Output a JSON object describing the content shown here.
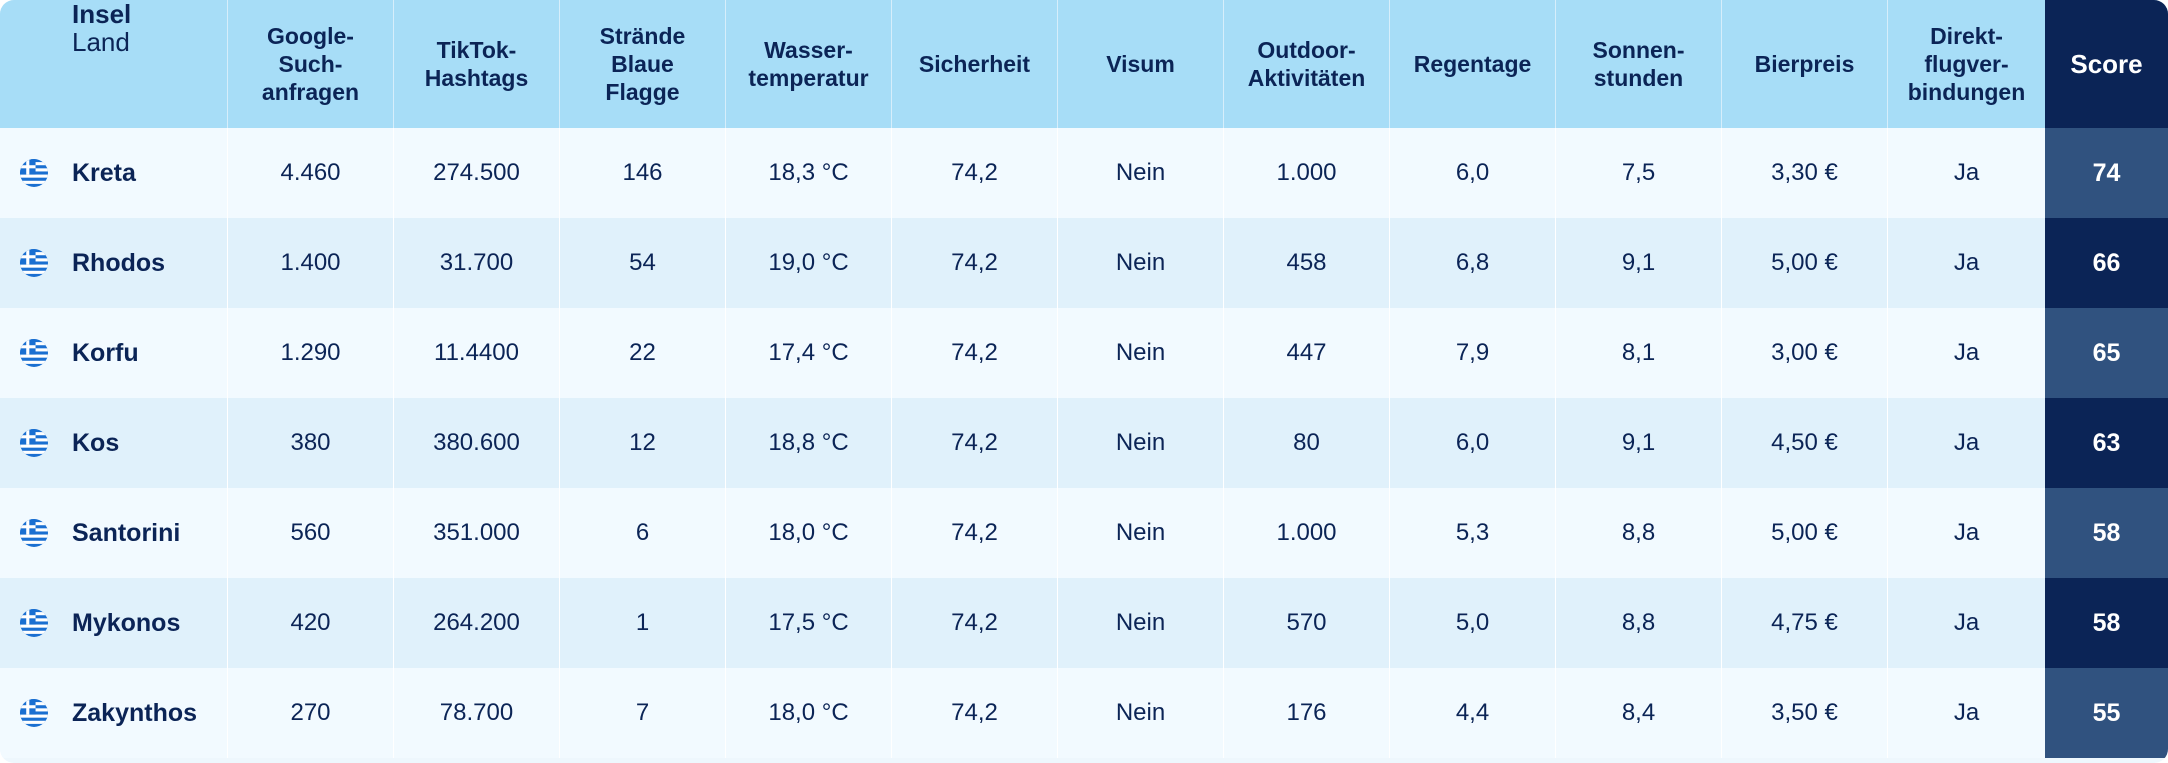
{
  "header": {
    "island": "Insel",
    "country": "Land",
    "columns": [
      "Google-\nSuch-\nanfragen",
      "TikTok-\nHashtags",
      "Strände\nBlaue\nFlagge",
      "Wasser-\ntemperatur",
      "Sicherheit",
      "Visum",
      "Outdoor-\nAktivitäten",
      "Regentage",
      "Sonnen-\nstunden",
      "Bierpreis",
      "Direkt-\nflugver-\nbindungen"
    ],
    "score": "Score"
  },
  "flag_icon": "greece-flag-icon",
  "colors": {
    "header_bg": "#a7ddf7",
    "score_header_bg": "#0b2456",
    "score_light": "#30527f",
    "score_dark": "#0b2456",
    "text": "#0b2456"
  },
  "rows": [
    {
      "name": "Kreta",
      "values": [
        "4.460",
        "274.500",
        "146",
        "18,3 °C",
        "74,2",
        "Nein",
        "1.000",
        "6,0",
        "7,5",
        "3,30 €",
        "Ja"
      ],
      "score": "74"
    },
    {
      "name": "Rhodos",
      "values": [
        "1.400",
        "31.700",
        "54",
        "19,0 °C",
        "74,2",
        "Nein",
        "458",
        "6,8",
        "9,1",
        "5,00 €",
        "Ja"
      ],
      "score": "66"
    },
    {
      "name": "Korfu",
      "values": [
        "1.290",
        "11.4400",
        "22",
        "17,4 °C",
        "74,2",
        "Nein",
        "447",
        "7,9",
        "8,1",
        "3,00 €",
        "Ja"
      ],
      "score": "65"
    },
    {
      "name": "Kos",
      "values": [
        "380",
        "380.600",
        "12",
        "18,8 °C",
        "74,2",
        "Nein",
        "80",
        "6,0",
        "9,1",
        "4,50 €",
        "Ja"
      ],
      "score": "63"
    },
    {
      "name": "Santorini",
      "values": [
        "560",
        "351.000",
        "6",
        "18,0 °C",
        "74,2",
        "Nein",
        "1.000",
        "5,3",
        "8,8",
        "5,00 €",
        "Ja"
      ],
      "score": "58"
    },
    {
      "name": "Mykonos",
      "values": [
        "420",
        "264.200",
        "1",
        "17,5 °C",
        "74,2",
        "Nein",
        "570",
        "5,0",
        "8,8",
        "4,75 €",
        "Ja"
      ],
      "score": "58"
    },
    {
      "name": "Zakynthos",
      "values": [
        "270",
        "78.700",
        "7",
        "18,0 °C",
        "74,2",
        "Nein",
        "176",
        "4,4",
        "8,4",
        "3,50 €",
        "Ja"
      ],
      "score": "55"
    }
  ]
}
